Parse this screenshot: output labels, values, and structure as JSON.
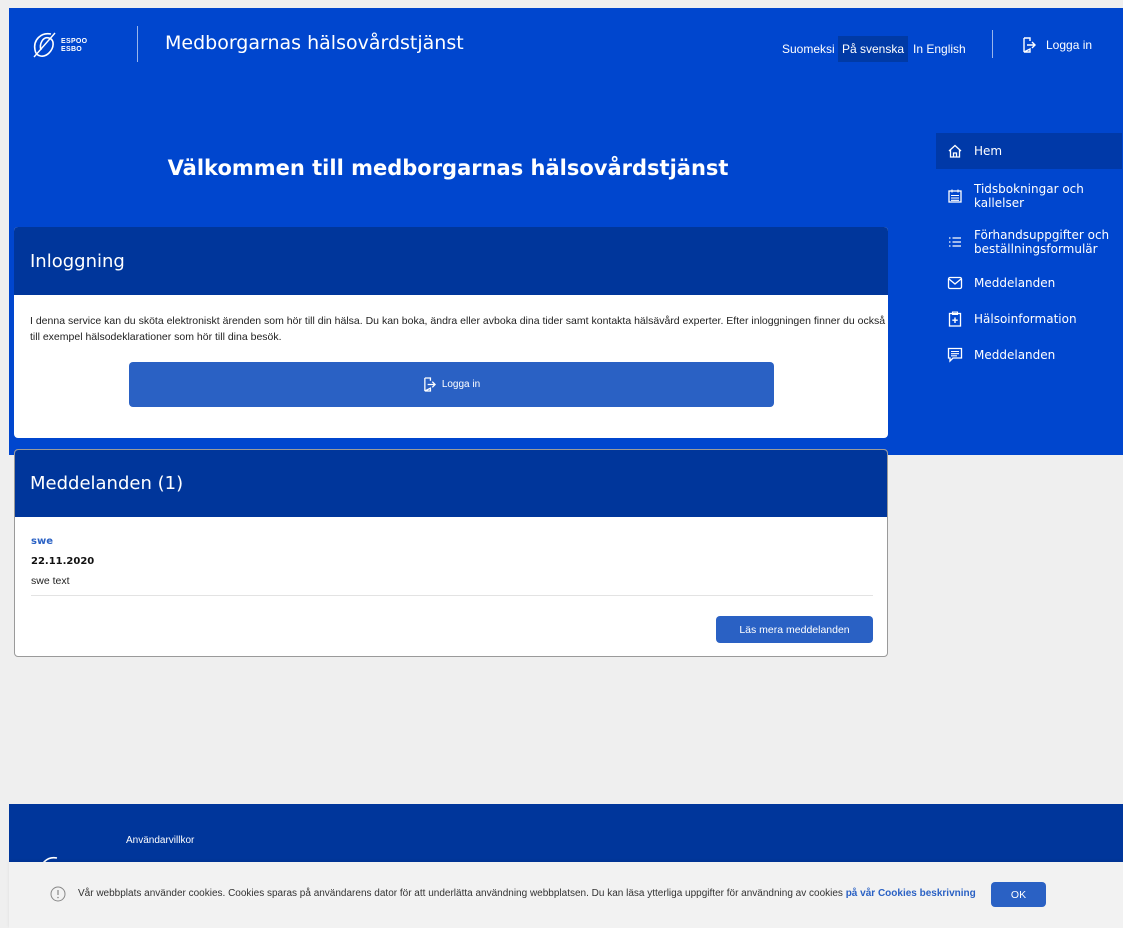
{
  "header": {
    "logo_text_line1": "ESPOO",
    "logo_text_line2": "ESBO",
    "app_title": "Medborgarnas hälsovårdstjänst",
    "languages": [
      "Suomeksi",
      "På svenska",
      "In English"
    ],
    "active_language": "På svenska",
    "login_label": "Logga in"
  },
  "hero": {
    "welcome_title": "Välkommen till medborgarnas hälsovårdstjänst"
  },
  "sidebar": {
    "items": [
      {
        "label": "Hem",
        "icon": "home-icon",
        "active": true
      },
      {
        "label": "Tidsbokningar och kallelser",
        "icon": "calendar-icon",
        "active": false
      },
      {
        "label": "Förhandsuppgifter och beställningsformulär",
        "icon": "list-icon",
        "active": false
      },
      {
        "label": "Meddelanden",
        "icon": "mail-icon",
        "active": false
      },
      {
        "label": "Hälsoinformation",
        "icon": "clipboard-plus-icon",
        "active": false
      },
      {
        "label": "Meddelanden",
        "icon": "chat-icon",
        "active": false
      }
    ]
  },
  "login_card": {
    "title": "Inloggning",
    "intro": "I denna service kan du sköta elektroniskt ärenden som hör till din hälsa. Du kan boka, ändra eller avboka dina tider samt kontakta hälsävård experter. Efter inloggningen finner du också till exempel hälsodeklarationer som hör till dina besök.",
    "button_label": "Logga in"
  },
  "messages_card": {
    "title": "Meddelanden (1)",
    "messages": [
      {
        "title": "swe",
        "date": "22.11.2020",
        "body": "swe text"
      }
    ],
    "more_button": "Läs mera meddelanden"
  },
  "footer": {
    "terms_link": "Användarvillkor"
  },
  "cookie_banner": {
    "text": "Vår webbplats använder cookies. Cookies sparas på användarens dator för att underlätta användning webbplatsen. Du kan läsa ytterliga uppgifter för användning av cookies ",
    "link_text": "på vår Cookies beskrivning",
    "ok_label": "OK"
  },
  "colors": {
    "brand_blue": "#0046ce",
    "dark_blue": "#00369b",
    "button_blue": "#2a61c4"
  }
}
